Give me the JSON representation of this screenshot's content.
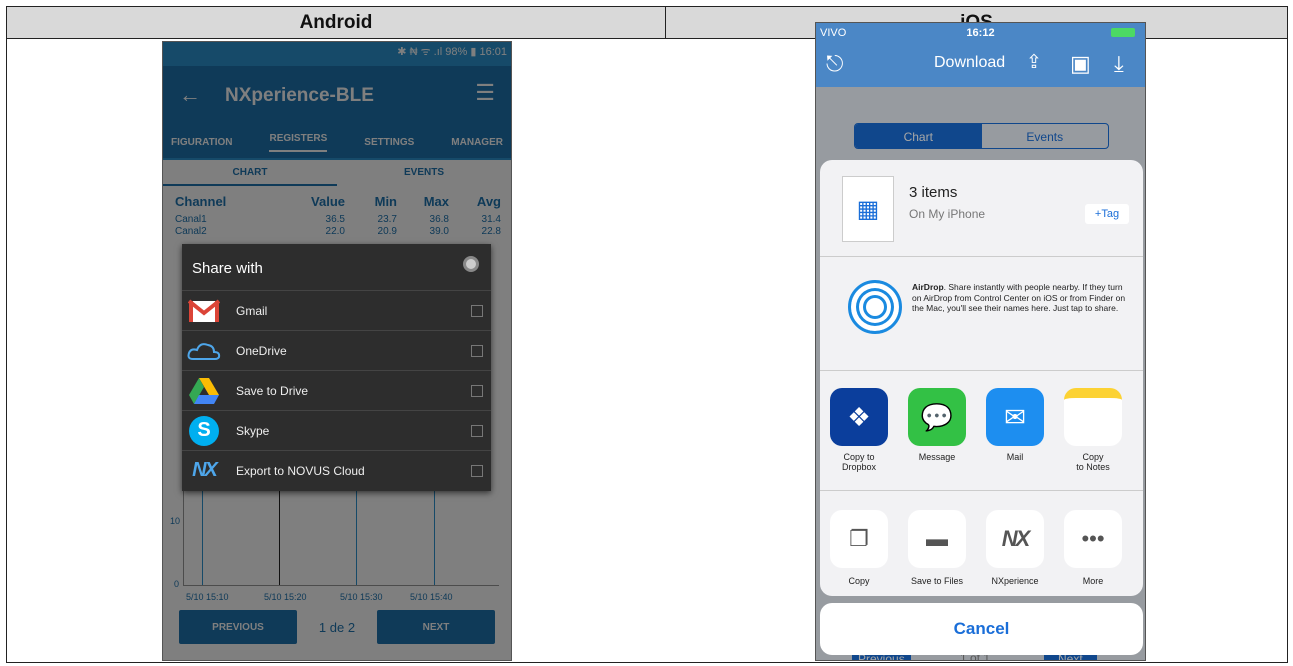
{
  "table": {
    "left_header": "Android",
    "right_header": "iOS"
  },
  "android": {
    "status": "✱ ₦ ᯤ .ıl 98% ▮ 16:01",
    "title": "NXperience-BLE",
    "tabs": [
      "FIGURATION",
      "REGISTERS",
      "SETTINGS",
      "MANAGER"
    ],
    "subtabs": [
      "CHART",
      "EVENTS"
    ],
    "table_headers": [
      "Channel",
      "Value",
      "Min",
      "Max",
      "Avg"
    ],
    "rows": [
      [
        "Canal1",
        "36.5",
        "23.7",
        "36.8",
        "31.4"
      ],
      [
        "Canal2",
        "22.0",
        "20.9",
        "39.0",
        "22.8"
      ]
    ],
    "chart_ticks_y": [
      "10",
      "0"
    ],
    "chart_ticks_x": [
      "5/10 15:10",
      "5/10 15:20",
      "5/10 15:30",
      "5/10 15:40"
    ],
    "pager": {
      "prev": "PREVIOUS",
      "page": "1 de 2",
      "next": "NEXT"
    },
    "share": {
      "title": "Share with",
      "items": [
        "Gmail",
        "OneDrive",
        "Save to Drive",
        "Skype",
        "Export to NOVUS Cloud"
      ]
    }
  },
  "ios": {
    "carrier": "VIVO",
    "time": "16:12",
    "nav_title": "Download",
    "segments": [
      "Chart",
      "Events"
    ],
    "doc": {
      "items": "3 items",
      "location": "On My iPhone",
      "tag": "+Tag"
    },
    "airdrop": {
      "bold": "AirDrop",
      "text": ". Share instantly with people nearby. If they turn on AirDrop from Control Center on iOS or from Finder on the Mac, you'll see their names here. Just tap to share."
    },
    "apps": [
      {
        "label": "Copy to\nDropbox",
        "icon": "dropbox-icon",
        "color": "#0b3e9c"
      },
      {
        "label": "Message",
        "icon": "message-icon",
        "color": "#33c145"
      },
      {
        "label": "Mail",
        "icon": "mail-icon",
        "color": "#1d8ef0"
      },
      {
        "label": "Copy\nto Notes",
        "icon": "notes-icon",
        "color": "#ffffff"
      }
    ],
    "actions": [
      "Copy",
      "Save to Files",
      "NXperience",
      "More"
    ],
    "pager": {
      "prev": "Previous",
      "page": "1 of 1",
      "next": "Next"
    },
    "cancel": "Cancel"
  }
}
